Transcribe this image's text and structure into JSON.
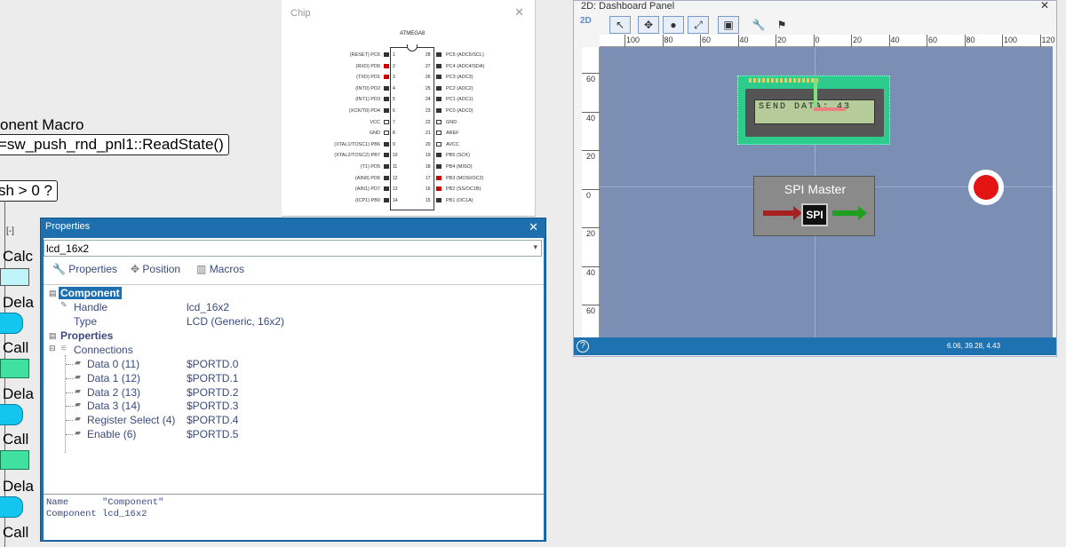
{
  "flowchart": {
    "macro_label": "onent Macro",
    "read_state": "=sw_push_rnd_pnl1::ReadState()",
    "decision": "sh > 0 ?",
    "collapse": "[-]",
    "items": [
      "Calc",
      "Dela",
      "Call",
      "Dela",
      "Call",
      "Dela",
      "Call"
    ]
  },
  "chip": {
    "title": "Chip",
    "name": "ATMEGA8",
    "left_pins": [
      {
        "label": "(RESET) PC6",
        "num": "1"
      },
      {
        "label": "(RXD) PD0",
        "num": "2"
      },
      {
        "label": "(TXD) PD1",
        "num": "3"
      },
      {
        "label": "(INT0) PD2",
        "num": "4"
      },
      {
        "label": "(INT1) PD3",
        "num": "5"
      },
      {
        "label": "(XCK/T0) PD4",
        "num": "6"
      },
      {
        "label": "VCC",
        "num": "7"
      },
      {
        "label": "GND",
        "num": "8"
      },
      {
        "label": "(XTAL1/TOSC1) PB6",
        "num": "9"
      },
      {
        "label": "(XTAL2/TOSC2) PB7",
        "num": "10"
      },
      {
        "label": "(T1) PD5",
        "num": "11"
      },
      {
        "label": "(AIN0) PD6",
        "num": "12"
      },
      {
        "label": "(AIN1) PD7",
        "num": "13"
      },
      {
        "label": "(ICP1) PB0",
        "num": "14"
      }
    ],
    "right_pins": [
      {
        "label": "PC5 (ADC5/SCL)",
        "num": "28"
      },
      {
        "label": "PC4 (ADC4/SDA)",
        "num": "27"
      },
      {
        "label": "PC3 (ADC3)",
        "num": "26"
      },
      {
        "label": "PC2 (ADC2)",
        "num": "25"
      },
      {
        "label": "PC1 (ADC1)",
        "num": "24"
      },
      {
        "label": "PC0 (ADC0)",
        "num": "23"
      },
      {
        "label": "GND",
        "num": "22"
      },
      {
        "label": "AREF",
        "num": "21"
      },
      {
        "label": "AVCC",
        "num": "20"
      },
      {
        "label": "PB5 (SCK)",
        "num": "19"
      },
      {
        "label": "PB4 (MISO)",
        "num": "18"
      },
      {
        "label": "PB3 (MOSI/OC2)",
        "num": "17"
      },
      {
        "label": "PB2 (SS/OC1B)",
        "num": "16"
      },
      {
        "label": "PB1 (OC1A)",
        "num": "15"
      }
    ]
  },
  "dashboard": {
    "title": "2D: Dashboard Panel",
    "mode": "2D",
    "ruler_top": [
      "100",
      "80",
      "60",
      "40",
      "20",
      "0",
      "20",
      "40",
      "60",
      "80",
      "100",
      "120"
    ],
    "ruler_left": [
      "60",
      "40",
      "20",
      "0",
      "20",
      "40",
      "60"
    ],
    "lcd_text": "SEND DATA: 43",
    "spi_title": "SPI Master",
    "spi_badge": "SPI",
    "status": "6.06, 39.28, 4.43",
    "help": "?"
  },
  "properties": {
    "title": "Properties",
    "selector": "lcd_16x2",
    "tabs": [
      "Properties",
      "Position",
      "Macros"
    ],
    "section_component": "Component",
    "handle_label": "Handle",
    "handle_value": "lcd_16x2",
    "type_label": "Type",
    "type_value": "LCD (Generic, 16x2)",
    "section_properties": "Properties",
    "connections_label": "Connections",
    "connections": [
      {
        "label": "Data 0 (11)",
        "value": "$PORTD.0"
      },
      {
        "label": "Data 1 (12)",
        "value": "$PORTD.1"
      },
      {
        "label": "Data 2 (13)",
        "value": "$PORTD.2"
      },
      {
        "label": "Data 3 (14)",
        "value": "$PORTD.3"
      },
      {
        "label": "Register Select (4)",
        "value": "$PORTD.4"
      },
      {
        "label": "Enable (6)",
        "value": "$PORTD.5"
      }
    ],
    "desc_line1": "Name      \"Component\"",
    "desc_line2": "Component lcd_16x2"
  }
}
